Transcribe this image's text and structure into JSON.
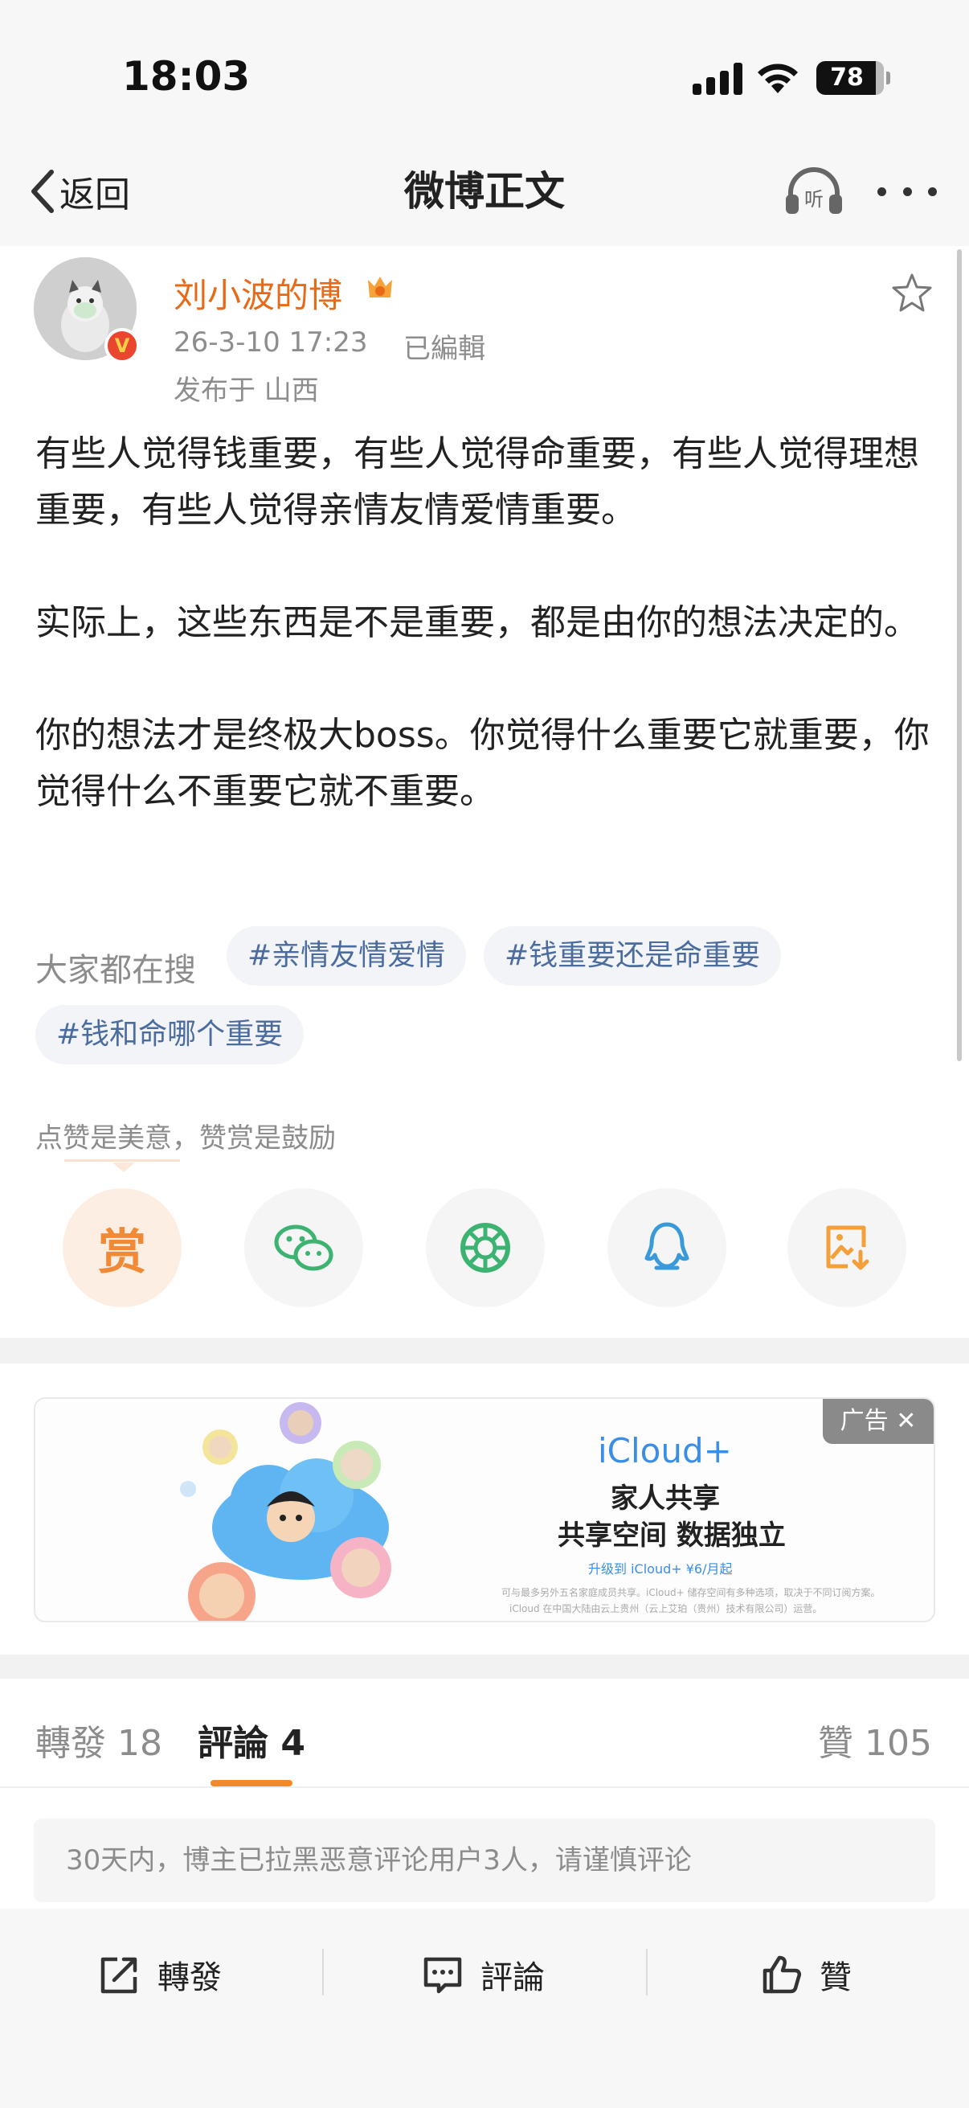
{
  "status_bar": {
    "time": "18:03",
    "battery": "78"
  },
  "nav": {
    "back_label": "返回",
    "title": "微博正文",
    "listen_icon_label": "听"
  },
  "post": {
    "username": "刘小波的博",
    "timestamp": "26-3-10 17:23",
    "edited": "已編輯",
    "location": "发布于 山西",
    "paragraphs": [
      "有些人觉得钱重要，有些人觉得命重要，有些人觉得理想重要，有些人觉得亲情友情爱情重要。",
      "实际上，这些东西是不是重要，都是由你的想法决定的。",
      "你的想法才是终极大boss。你觉得什么重要它就重要，你觉得什么不重要它就不重要。"
    ]
  },
  "hot_search": {
    "label": "大家都在搜",
    "tags": [
      "#亲情友情爱情",
      "#钱重要还是命重要",
      "#钱和命哪个重要"
    ]
  },
  "reward": {
    "text": "点赞是美意，赞赏是鼓励",
    "reward_char": "赏",
    "buttons": [
      "reward",
      "wechat",
      "moments",
      "qq",
      "save-image"
    ]
  },
  "ad": {
    "tag": "广告 ✕",
    "brand": "iCloud+",
    "line1": "家人共享",
    "line2": "共享空间 数据独立",
    "cta": "升级到 iCloud+ ¥6/月起",
    "fine1": "可与最多另外五名家庭成员共享。iCloud+ 储存空间有多种选项，取决于不同订阅方案。",
    "fine2": "iCloud 在中国大陆由云上贵州（云上艾珀（贵州）技术有限公司）运营。"
  },
  "tabs": {
    "repost": "轉發 18",
    "comment": "評論 4",
    "like": "贊 105"
  },
  "notice": "30天内，博主已拉黑恶意评论用户3人，请谨慎评论",
  "bottom_bar": {
    "repost": "轉發",
    "comment": "評論",
    "like": "贊"
  },
  "colors": {
    "accent_orange": "#f28a2c",
    "username_orange": "#e86a16",
    "tag_blue": "#4b6c9e",
    "wechat_green": "#3cb371",
    "qq_blue": "#3a9ad9"
  }
}
